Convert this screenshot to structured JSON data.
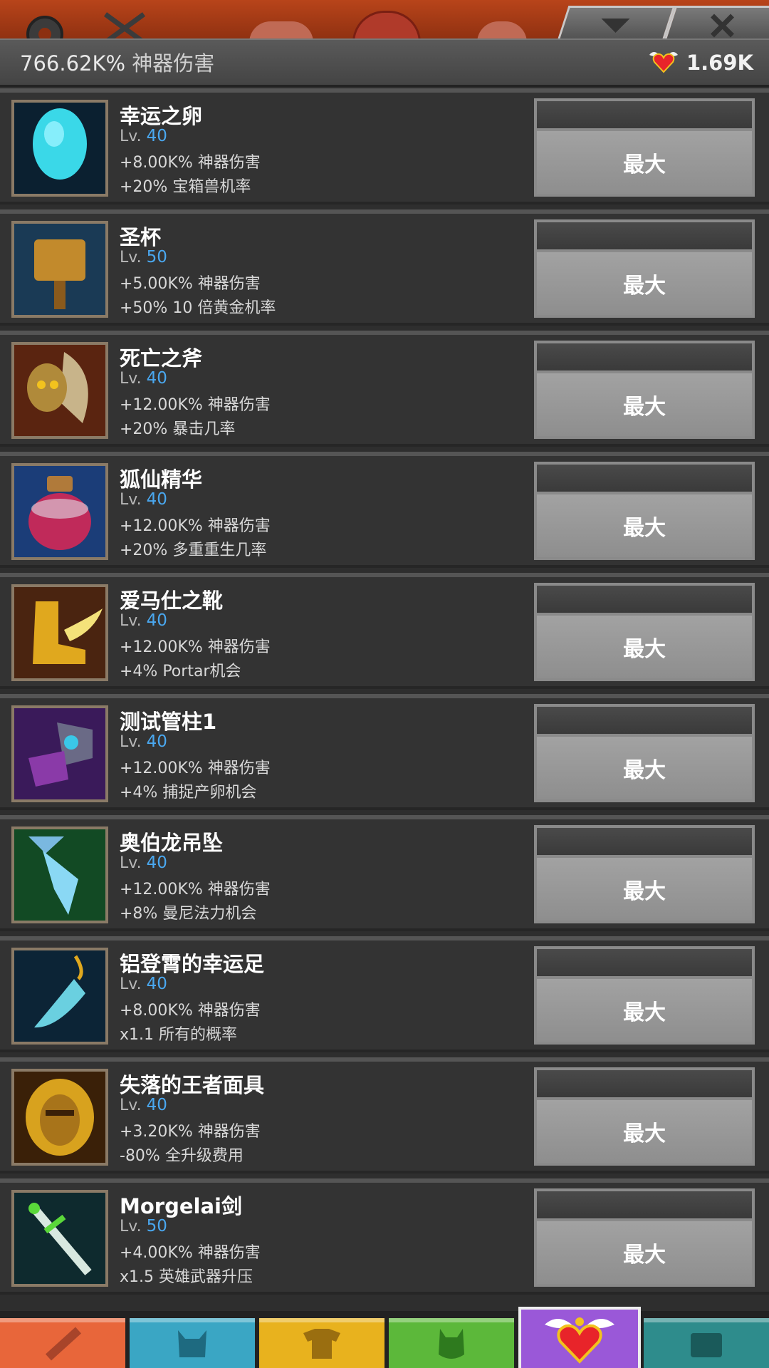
{
  "header": {
    "damage_value": "766.62K%",
    "damage_label": "神器伤害",
    "currency_icon": "winged-heart-icon",
    "currency_value": "1.69K"
  },
  "top_tabs": {
    "left_icons": [
      "gear-icon",
      "crossed-swords-icon"
    ],
    "right_tabs": [
      "down-arrow-icon",
      "close-icon"
    ]
  },
  "artifacts": [
    {
      "icon": "egg-icon",
      "name": "幸运之卵",
      "level_label": "Lv.",
      "level": "40",
      "bonus1": "+8.00K% 神器伤害",
      "bonus2": "+20% 宝箱兽机率",
      "button": "最大"
    },
    {
      "icon": "chalice-icon",
      "name": "圣杯",
      "level_label": "Lv.",
      "level": "50",
      "bonus1": "+5.00K% 神器伤害",
      "bonus2": "+50% 10 倍黄金机率",
      "button": "最大"
    },
    {
      "icon": "axe-icon",
      "name": "死亡之斧",
      "level_label": "Lv.",
      "level": "40",
      "bonus1": "+12.00K% 神器伤害",
      "bonus2": "+20% 暴击几率",
      "button": "最大"
    },
    {
      "icon": "potion-icon",
      "name": "狐仙精华",
      "level_label": "Lv.",
      "level": "40",
      "bonus1": "+12.00K% 神器伤害",
      "bonus2": "+20% 多重重生几率",
      "button": "最大"
    },
    {
      "icon": "winged-boot-icon",
      "name": "爱马仕之靴",
      "level_label": "Lv.",
      "level": "40",
      "bonus1": "+12.00K% 神器伤害",
      "bonus2": "+4% Portar机会",
      "button": "最大"
    },
    {
      "icon": "gauntlet-icon",
      "name": "测试管柱1",
      "level_label": "Lv.",
      "level": "40",
      "bonus1": "+12.00K% 神器伤害",
      "bonus2": "+4% 捕捉产卵机会",
      "button": "最大"
    },
    {
      "icon": "crystal-pendant-icon",
      "name": "奥伯龙吊坠",
      "level_label": "Lv.",
      "level": "40",
      "bonus1": "+12.00K% 神器伤害",
      "bonus2": "+8% 曼尼法力机会",
      "button": "最大"
    },
    {
      "icon": "lucky-foot-icon",
      "name": "铝登霄的幸运足",
      "level_label": "Lv.",
      "level": "40",
      "bonus1": "+8.00K% 神器伤害",
      "bonus2": "x1.1 所有的概率",
      "button": "最大"
    },
    {
      "icon": "golden-mask-icon",
      "name": "失落的王者面具",
      "level_label": "Lv.",
      "level": "40",
      "bonus1": "+3.20K% 神器伤害",
      "bonus2": "-80% 全升级费用",
      "button": "最大"
    },
    {
      "icon": "sword-icon",
      "name": "Morgelai剑",
      "level_label": "Lv.",
      "level": "50",
      "bonus1": "+4.00K% 神器伤害",
      "bonus2": "x1.5 英雄武器升压",
      "button": "最大"
    }
  ],
  "bottom_tabs": [
    {
      "icon": "sword-tab-icon",
      "color": "#e8663a"
    },
    {
      "icon": "helmet-tab-icon",
      "color": "#3aa6c4"
    },
    {
      "icon": "shirt-tab-icon",
      "color": "#e8b21e"
    },
    {
      "icon": "pet-tab-icon",
      "color": "#5cb83a"
    },
    {
      "icon": "artifact-tab-icon",
      "color": "#9a58d8"
    },
    {
      "icon": "chest-tab-icon",
      "color": "#2e8c8c"
    }
  ],
  "active_tab_index": 4
}
